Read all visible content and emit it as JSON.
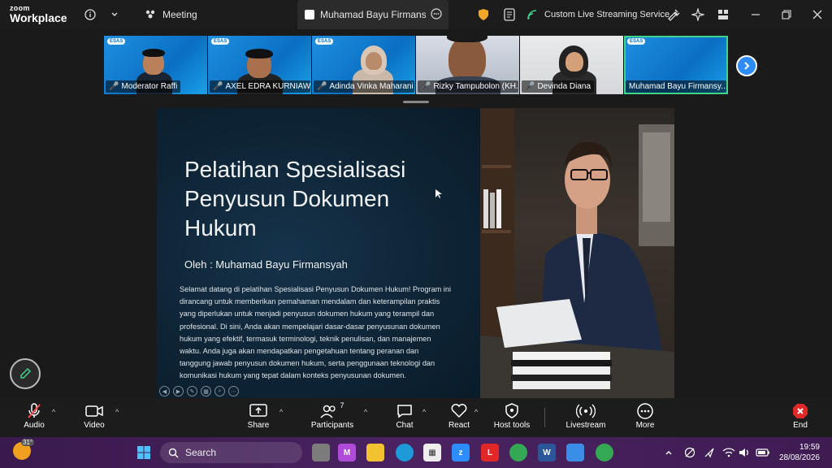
{
  "titlebar": {
    "logo_top": "zoom",
    "logo_bottom": "Workplace",
    "meeting_label": "Meeting",
    "active_tab": "Muhamad Bayu Firmansyah-Kc",
    "streaming_label": "Custom Live Streaming Service"
  },
  "participants_strip": [
    {
      "name": "Moderator Raffi"
    },
    {
      "name": "AXEL EDRA KURNIAW..."
    },
    {
      "name": "Adinda Vinka Maharani"
    },
    {
      "name": "Rizky Tampubolon (KH..."
    },
    {
      "name": "Devinda Diana"
    },
    {
      "name": "Muhamad Bayu Firmansy..."
    }
  ],
  "slide": {
    "title": "Pelatihan Spesialisasi Penyusun Dokumen Hukum",
    "author": "Oleh : Muhamad Bayu Firmansyah",
    "body": "Selamat datang di pelatihan Spesialisasi Penyusun Dokumen Hukum! Program ini dirancang untuk memberikan pemahaman mendalam dan keterampilan praktis yang diperlukan untuk menjadi penyusun dokumen hukum yang terampil dan profesional. Di sini, Anda akan mempelajari dasar-dasar penyusunan dokumen hukum yang efektif, termasuk terminologi, teknik penulisan, dan manajemen waktu. Anda juga akan mendapatkan pengetahuan tentang peranan dan tanggung jawab penyusun dokumen hukum, serta penggunaan teknologi dan komunikasi hukum yang tepat dalam konteks penyusunan dokumen."
  },
  "toolbar": {
    "audio": "Audio",
    "video": "Video",
    "share": "Share",
    "participants": "Participants",
    "participants_count": "7",
    "chat": "Chat",
    "react": "React",
    "host_tools": "Host tools",
    "livestream": "Livestream",
    "more": "More",
    "end": "End"
  },
  "taskbar": {
    "temperature": "31°",
    "search_placeholder": "Search",
    "time": "19:59",
    "date": "28/08/2026"
  },
  "colors": {
    "zoom_blue": "#2d8cff",
    "active_border": "#3fd38b",
    "end_red": "#e02828",
    "muted_red": "#ff4a4a"
  }
}
